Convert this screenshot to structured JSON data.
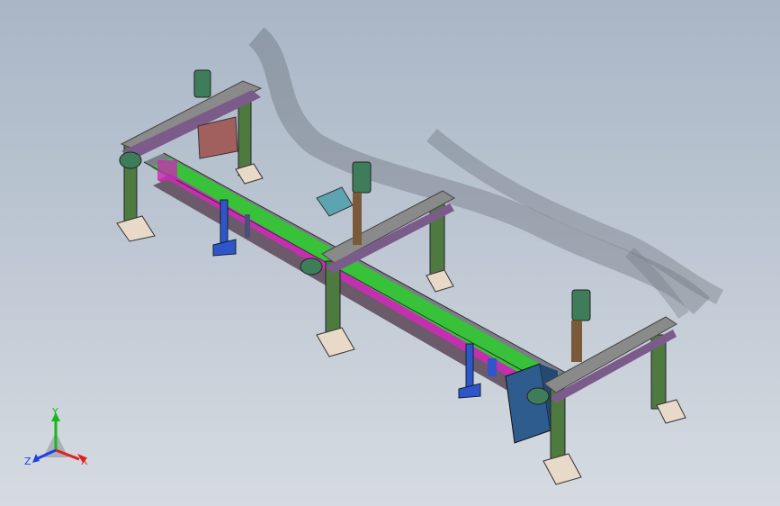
{
  "viewport": {
    "background_top": "#a9b6c6",
    "background_bottom": "#d6dbe1"
  },
  "model": {
    "frame_color": "#4f7a3f",
    "beam_color": "#8a8a8a",
    "belt_color": "#37c23a",
    "rail_color": "#c42fb0",
    "support_color": "#2f56c9",
    "foot_color": "#e9d9c8",
    "motor_color": "#3f7d5a",
    "cabinet_color": "#2e5c8e"
  },
  "triad": {
    "x_label": "X",
    "y_label": "Y",
    "z_label": "Z",
    "x_color": "#e02020",
    "y_color": "#18b818",
    "z_color": "#2040e0"
  }
}
